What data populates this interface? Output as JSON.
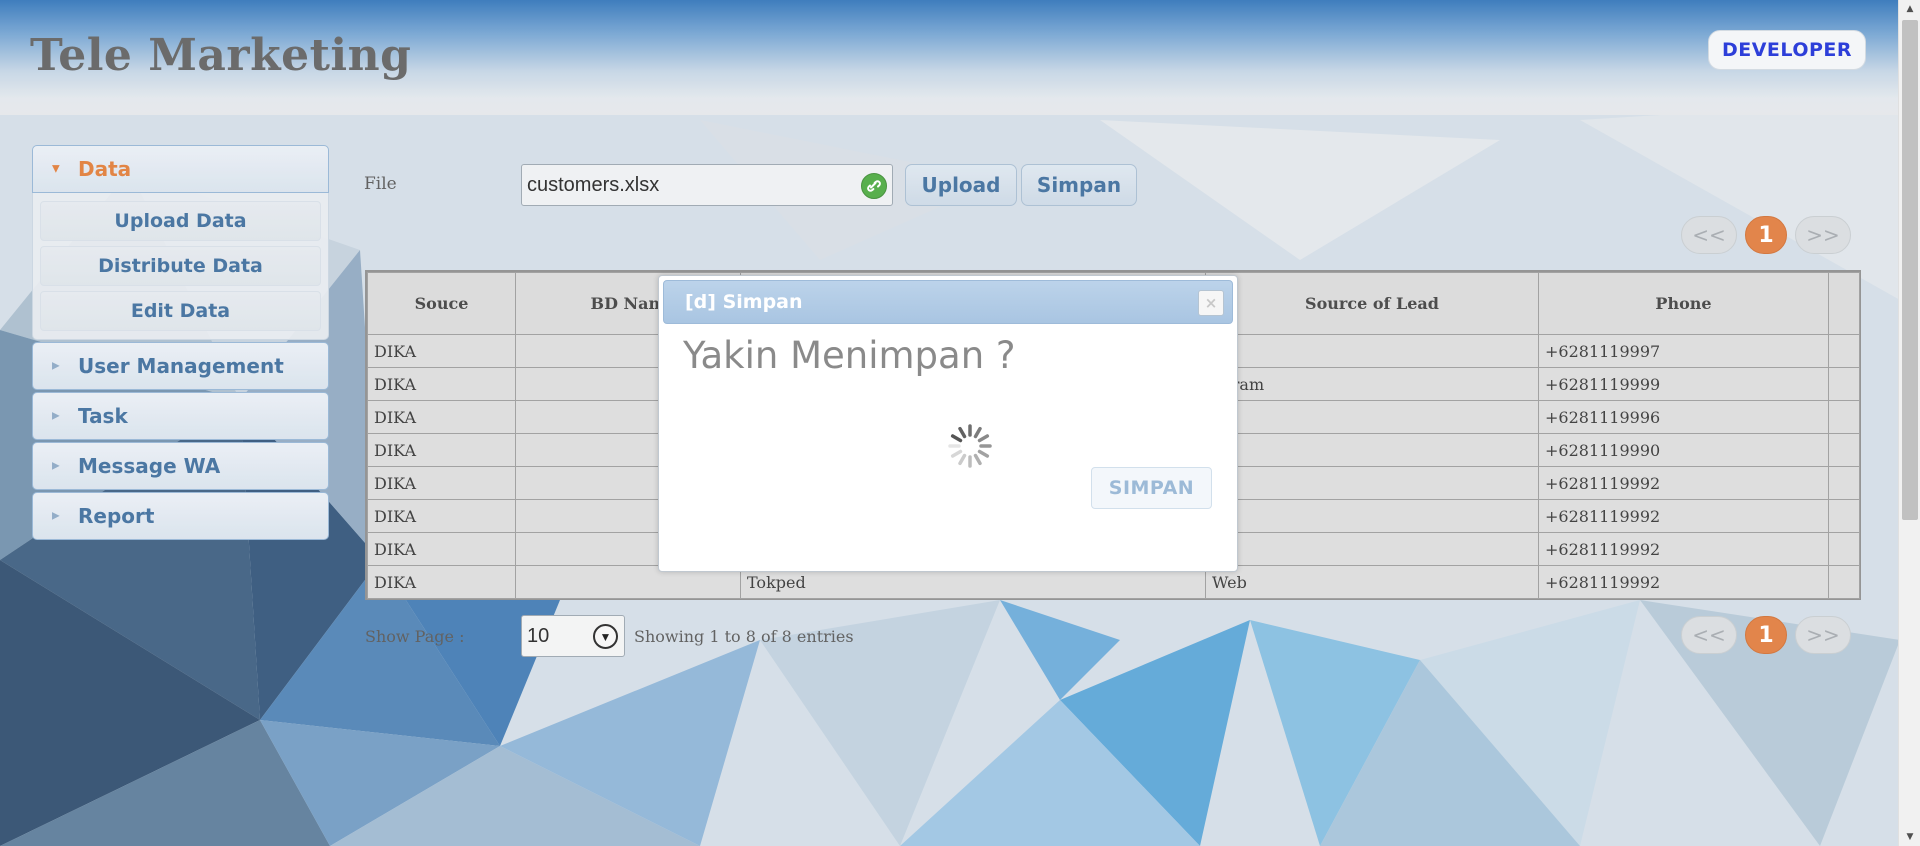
{
  "app": {
    "title": "Tele Marketing",
    "role_badge": "DEVELOPER"
  },
  "sidebar": {
    "sections": [
      {
        "label": "Data",
        "open": true,
        "items": [
          "Upload Data",
          "Distribute Data",
          "Edit Data"
        ]
      },
      {
        "label": "User Management",
        "open": false
      },
      {
        "label": "Task",
        "open": false
      },
      {
        "label": "Message WA",
        "open": false
      },
      {
        "label": "Report",
        "open": false
      }
    ]
  },
  "upload": {
    "file_label": "File",
    "file_value": "customers.xlsx",
    "upload_button": "Upload",
    "save_button": "Simpan"
  },
  "pagination": {
    "prev": "<<",
    "current": "1",
    "next": ">>"
  },
  "table": {
    "headers": [
      "Souce",
      "BD Nam",
      "",
      "Source of Lead",
      "Phone",
      ""
    ],
    "rows": [
      [
        "DIKA",
        "",
        "",
        "b",
        "+6281119997",
        ""
      ],
      [
        "DIKA",
        "",
        "",
        "agram",
        "+6281119999",
        ""
      ],
      [
        "DIKA",
        "",
        "",
        "b",
        "+6281119996",
        ""
      ],
      [
        "DIKA",
        "",
        "",
        "b",
        "+6281119990",
        ""
      ],
      [
        "DIKA",
        "",
        "",
        "b",
        "+6281119992",
        ""
      ],
      [
        "DIKA",
        "",
        "",
        "b",
        "+6281119992",
        ""
      ],
      [
        "DIKA",
        "",
        "",
        "b",
        "+6281119992",
        ""
      ],
      [
        "DIKA",
        "",
        "Tokped",
        "Web",
        "+6281119992",
        ""
      ]
    ]
  },
  "footer": {
    "show_page_label": "Show Page :",
    "page_size": "10",
    "entries_info": "Showing 1 to 8 of 8 entries"
  },
  "dialog": {
    "title": "[d] Simpan",
    "close_symbol": "×",
    "message": "Yakin Menimpan ?",
    "confirm_button": "SIMPAN"
  },
  "colors": {
    "accent_orange": "#e07b3c",
    "link_blue": "#3c6c9c",
    "badge_text": "#1c2fd6"
  }
}
